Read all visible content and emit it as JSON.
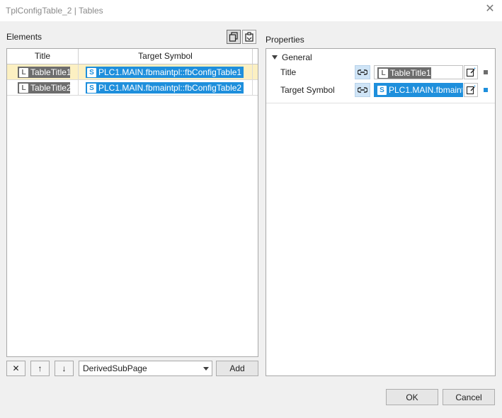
{
  "window": {
    "title": "TplConfigTable_2 | Tables",
    "close_glyph": "✕"
  },
  "elements_panel": {
    "label": "Elements",
    "columns": [
      "Title",
      "Target Symbol"
    ],
    "rows": [
      {
        "title_badge": "L",
        "title": "TableTitle1",
        "symbol_badge": "S",
        "symbol": "PLC1.MAIN.fbmaintpl::fbConfigTable1",
        "selected": true
      },
      {
        "title_badge": "L",
        "title": "TableTitle2",
        "symbol_badge": "S",
        "symbol": "PLC1.MAIN.fbmaintpl::fbConfigTable2",
        "selected": false
      }
    ],
    "toolbar_icons": [
      "copy-icon",
      "paste-icon"
    ]
  },
  "bottom_toolbar": {
    "delete_glyph": "✕",
    "up_glyph": "↑",
    "down_glyph": "↓",
    "combo_value": "DerivedSubPage",
    "add_label": "Add"
  },
  "properties_panel": {
    "label": "Properties",
    "group": "General",
    "items": [
      {
        "label": "Title",
        "badge": "L",
        "value": "TableTitle1",
        "indicator_color": "#6d6d6d"
      },
      {
        "label": "Target Symbol",
        "badge": "S",
        "value": "PLC1.MAIN.fbmaint",
        "indicator_color": "#1e8fdc"
      }
    ]
  },
  "dialog_buttons": {
    "ok": "OK",
    "cancel": "Cancel"
  },
  "colors": {
    "selected_row": "#fcf0c2",
    "symbol_chip": "#1e8fdc",
    "label_chip": "#6d6d6d",
    "link_button": "#cfe4f6"
  }
}
